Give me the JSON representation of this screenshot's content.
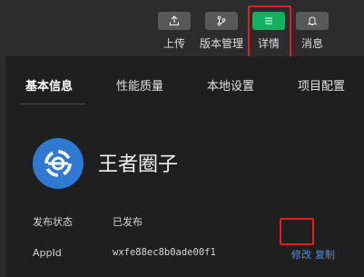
{
  "toolbar": {
    "upload_label": "上传",
    "version_label": "版本管理",
    "details_label": "详情",
    "message_label": "消息",
    "icons": {
      "upload": "upload-icon",
      "version": "branch-icon",
      "details": "menu-icon",
      "message": "bell-icon"
    },
    "active_color": "#13b060"
  },
  "tabs": [
    {
      "label": "基本信息",
      "active": true
    },
    {
      "label": "性能质量",
      "active": false
    },
    {
      "label": "本地设置",
      "active": false
    },
    {
      "label": "项目配置",
      "active": false
    }
  ],
  "app": {
    "name": "王者圈子",
    "logo_color": "#2f79d3"
  },
  "info": {
    "status_label": "发布状态",
    "status_value": "已发布",
    "appid_label": "AppId",
    "appid_value": "wxfe88ec8b0ade00f1",
    "modify_link": "修改",
    "copy_link": "复制"
  },
  "highlight_color": "#e02020"
}
